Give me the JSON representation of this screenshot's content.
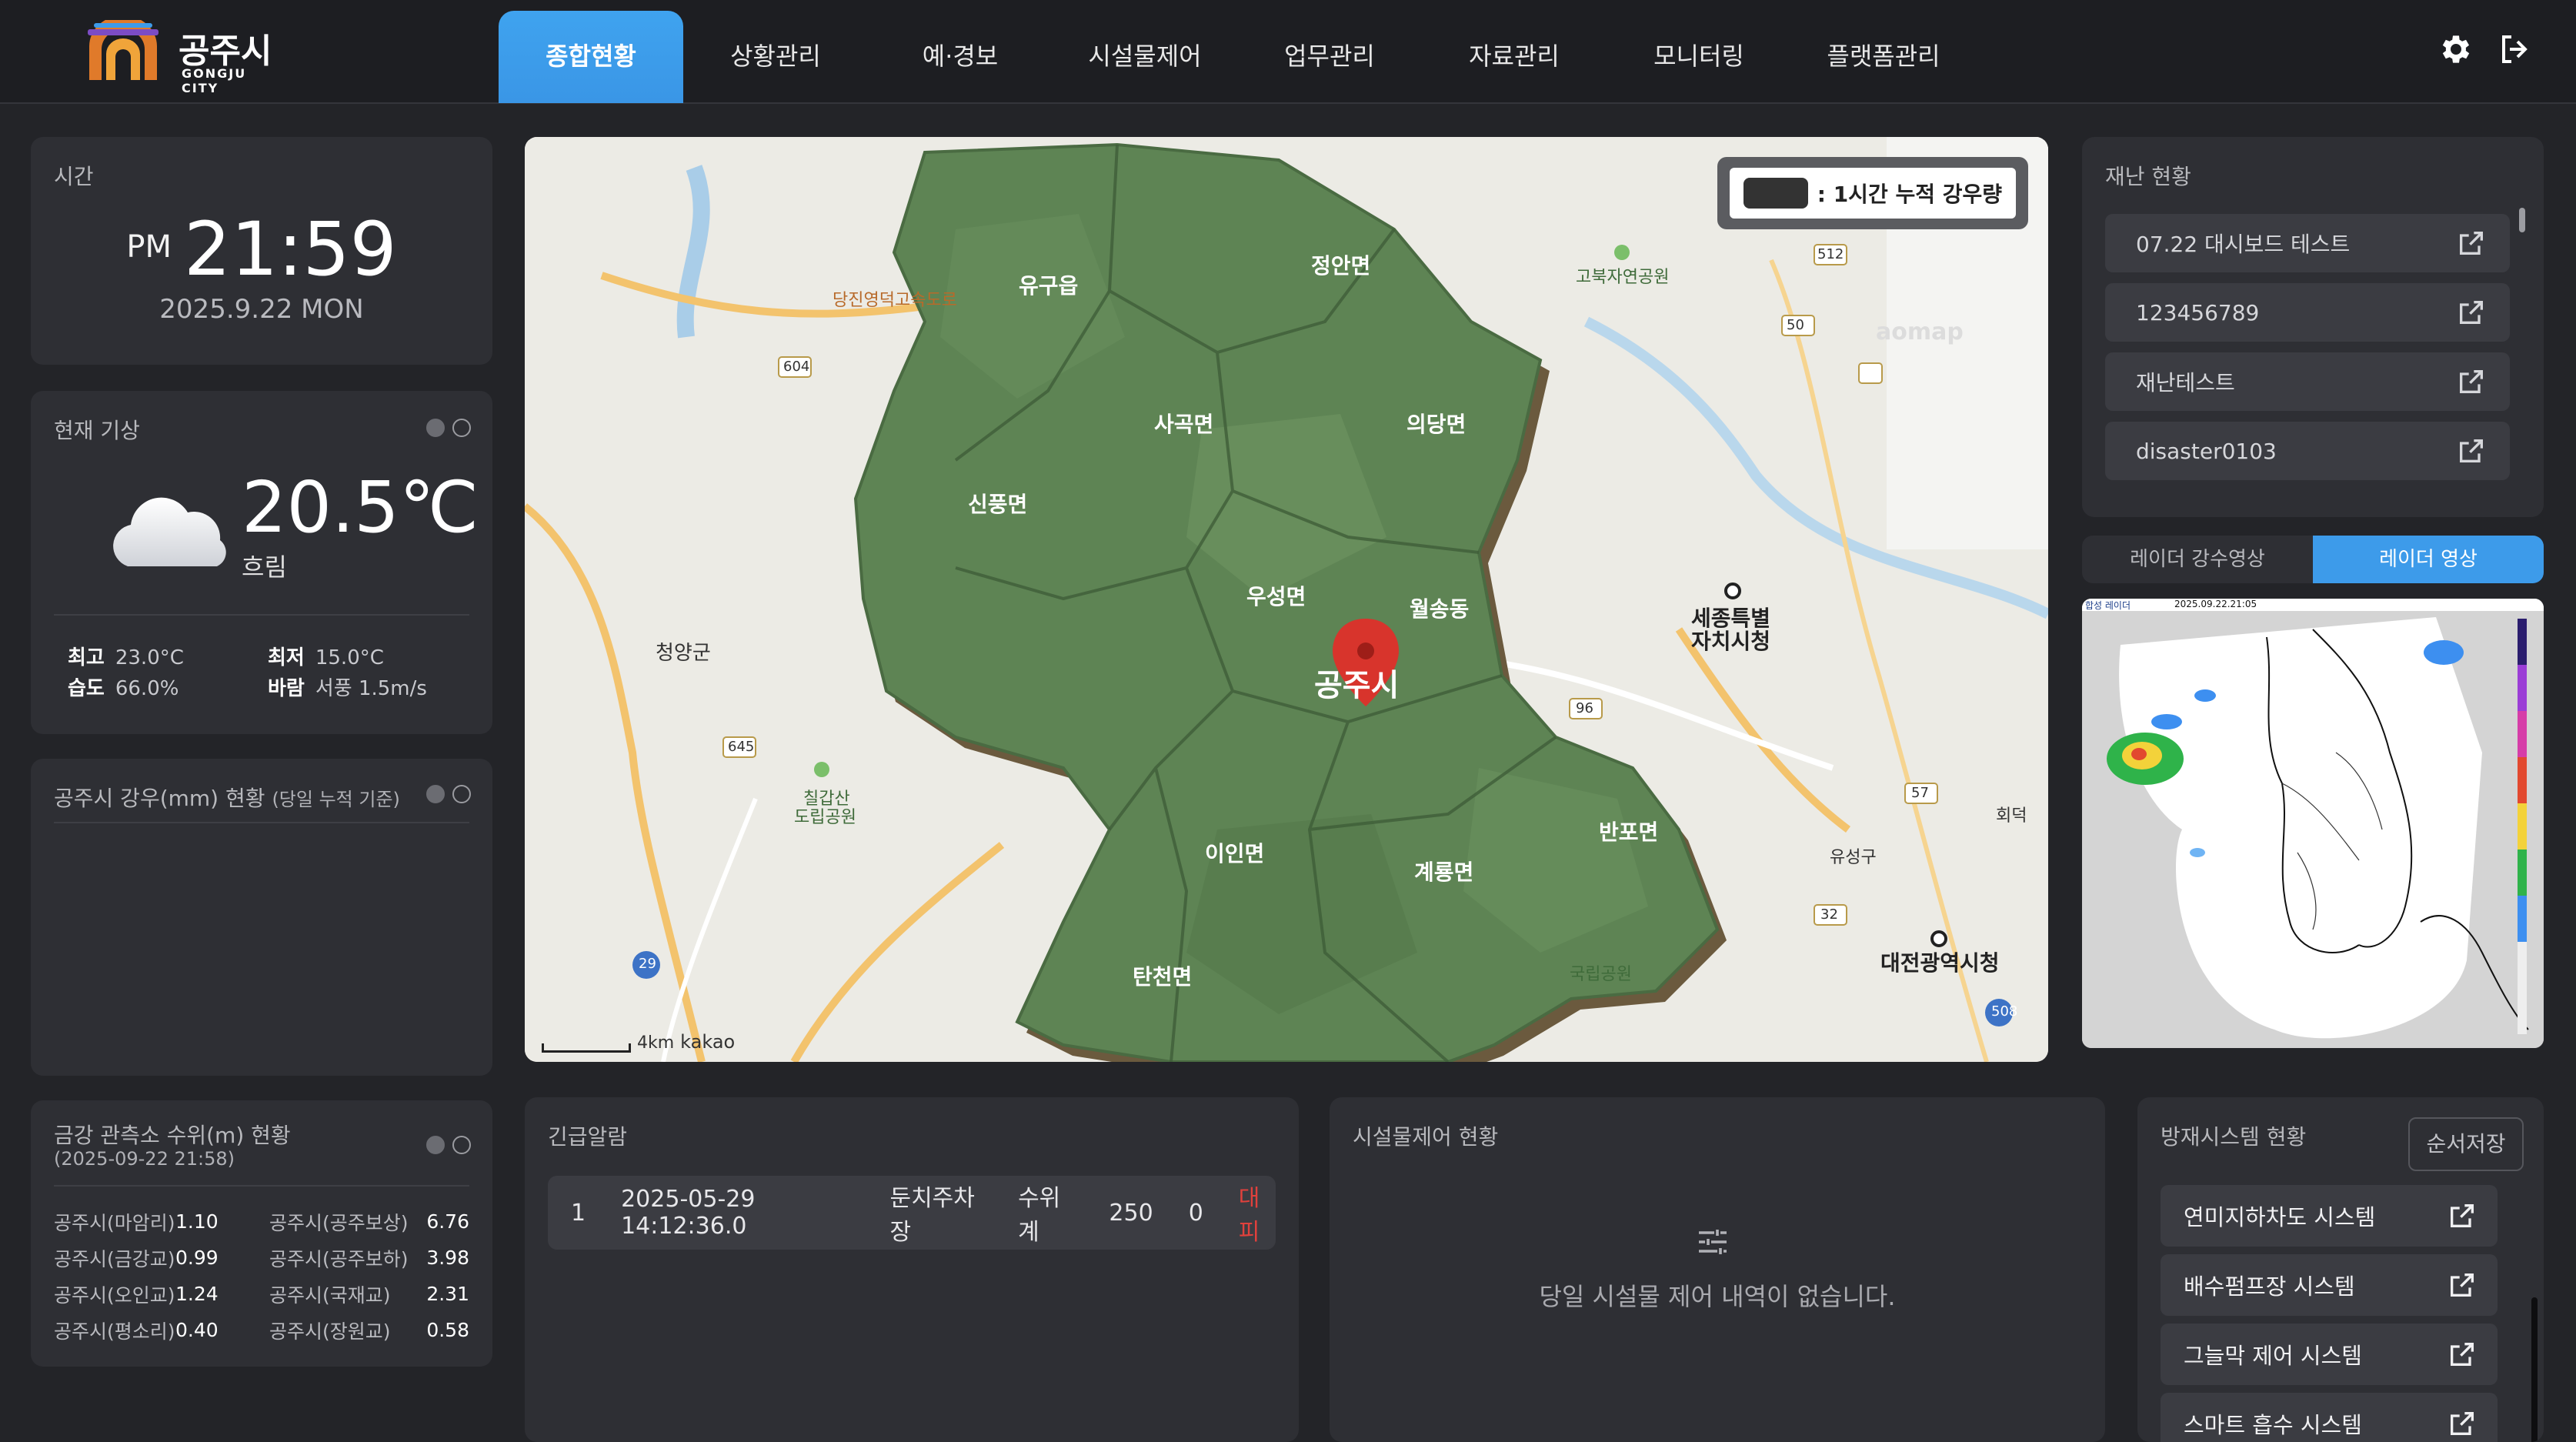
{
  "app": {
    "logo_title": "공주시",
    "logo_sub": "GONGJU CITY"
  },
  "nav": {
    "items": [
      "종합현황",
      "상황관리",
      "예·경보",
      "시설물제어",
      "업무관리",
      "자료관리",
      "모니터링",
      "플랫폼관리"
    ],
    "active_index": 0
  },
  "header_icons": [
    "settings-icon",
    "logout-icon"
  ],
  "time_panel": {
    "title": "시간",
    "ampm": "PM",
    "clock": "21:59",
    "date": "2025.9.22 MON"
  },
  "weather": {
    "title": "현재 기상",
    "temp": "20.5℃",
    "condition": "흐림",
    "icon": "cloud-icon",
    "max_label": "최고",
    "max_value": "23.0°C",
    "min_label": "최저",
    "min_value": "15.0°C",
    "humidity_label": "습도",
    "humidity_value": "66.0%",
    "wind_label": "바람",
    "wind_value": "서풍 1.5m/s"
  },
  "rain": {
    "title": "공주시 강우(mm) 현황",
    "subtitle": "(당일 누적 기준)"
  },
  "water_level": {
    "title": "금강 관측소 수위(m) 현황",
    "date": "(2025-09-22 21:58)",
    "rows": [
      {
        "name1": "공주시(마암리)",
        "val1": "1.10",
        "name2": "공주시(공주보상)",
        "val2": "6.76"
      },
      {
        "name1": "공주시(금강교)",
        "val1": "0.99",
        "name2": "공주시(공주보하)",
        "val2": "3.98"
      },
      {
        "name1": "공주시(오인교)",
        "val1": "1.24",
        "name2": "공주시(국재교)",
        "val2": "2.31"
      },
      {
        "name1": "공주시(평소리)",
        "val1": "0.40",
        "name2": "공주시(장원교)",
        "val2": "0.58"
      }
    ]
  },
  "map": {
    "legend": ": 1시간 누적 강우량",
    "city_label": "공주시",
    "scale_label": "4km",
    "attribution": "kakao",
    "watermark": "aomap",
    "districts": [
      "유구읍",
      "정안면",
      "사곡면",
      "의당면",
      "신풍면",
      "우성면",
      "월송동",
      "이인면",
      "계룡면",
      "반포면",
      "탄천면"
    ],
    "places": [
      "청양군",
      "세종특별",
      "자치시청",
      "대전광역시청",
      "고북자연공원",
      "칠갑산",
      "도립공원",
      "유성구",
      "회덕",
      "국립공원",
      "당진영덕고속도로"
    ],
    "road_numbers": [
      "604",
      "645",
      "29",
      "96",
      "57",
      "32",
      "508",
      "512",
      "50"
    ]
  },
  "disaster": {
    "title": "재난 현황",
    "items": [
      "07.22 대시보드 테스트",
      "123456789",
      "재난테스트",
      "disaster0103"
    ]
  },
  "radar": {
    "tabs": [
      "레이더 강수영상",
      "레이더 영상"
    ],
    "active_index": 1,
    "stamp": "2025.09.22.21:05",
    "caption": "합성 레이더"
  },
  "alarm": {
    "title": "긴급알람",
    "row": {
      "no": "1",
      "datetime": "2025-05-29 14:12:36.0",
      "place": "둔치주차장",
      "sensor": "수위계",
      "value": "250",
      "count": "0",
      "status": "대피"
    }
  },
  "facility": {
    "title": "시설물제어 현황",
    "empty": "당일 시설물 제어 내역이 없습니다."
  },
  "defense": {
    "title": "방재시스템 현황",
    "save": "순서저장",
    "items": [
      "연미지하차도 시스템",
      "배수펌프장 시스템",
      "그늘막 제어 시스템",
      "스마트 흡수 시스템"
    ]
  },
  "colors": {
    "bg": "#232428",
    "panel": "#2e2f34",
    "accent": "#3d9bea",
    "alert": "#e0413c",
    "map_land": "#5e8454"
  }
}
